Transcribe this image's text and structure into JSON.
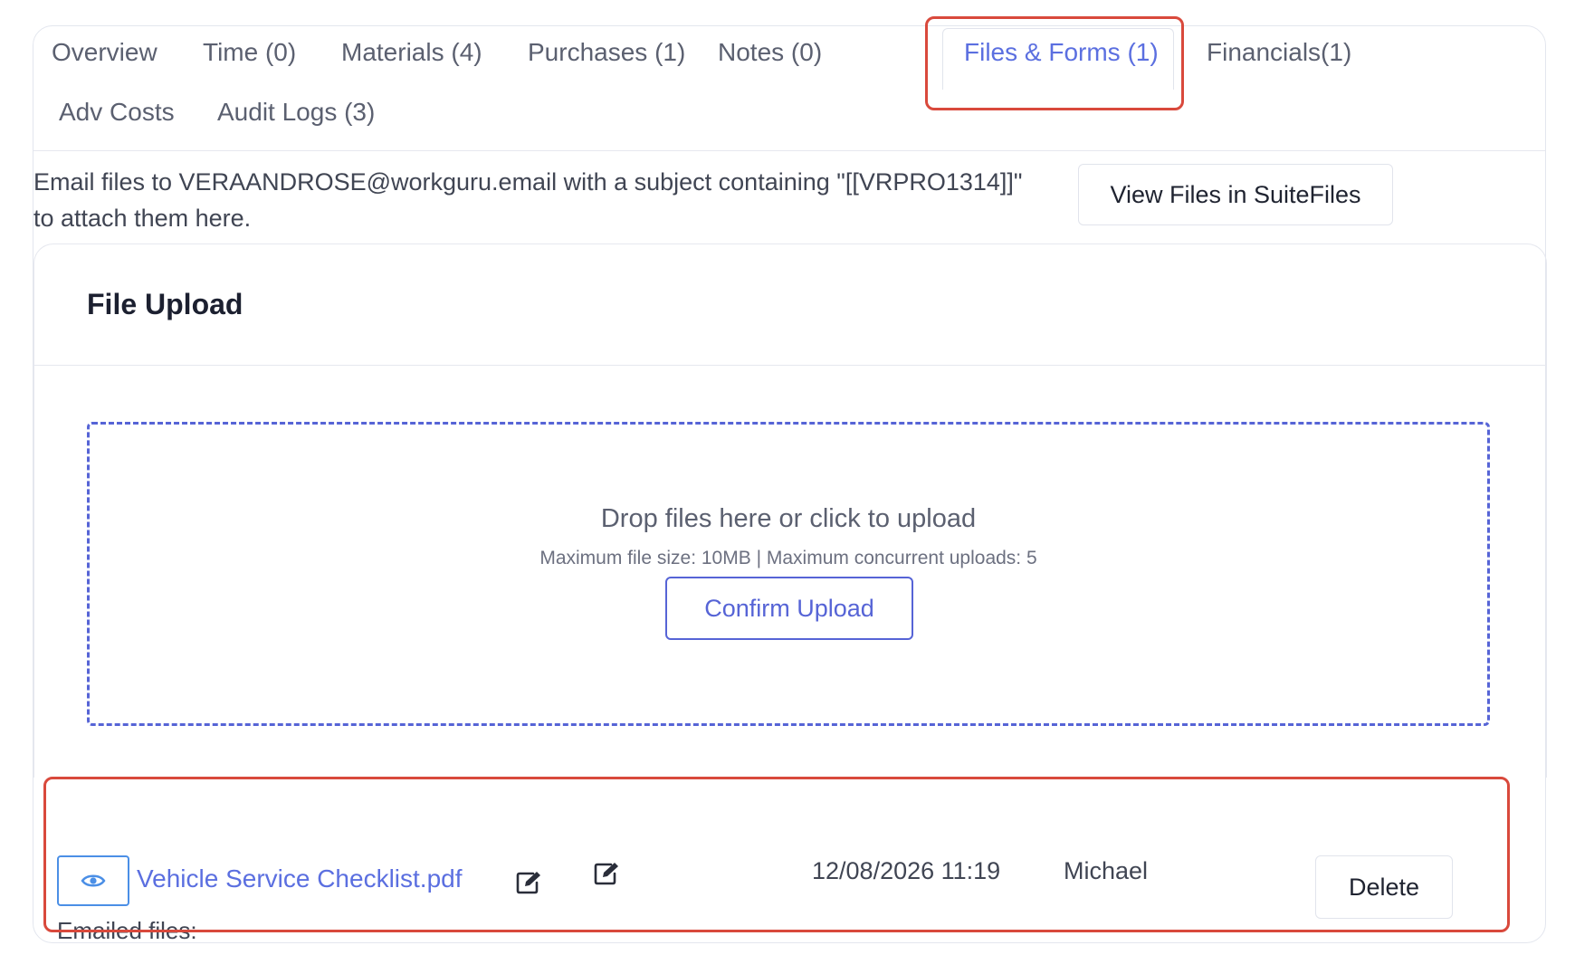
{
  "tabs": [
    {
      "label": "Overview"
    },
    {
      "label": "Time (0)"
    },
    {
      "label": "Materials (4)"
    },
    {
      "label": "Purchases (1)"
    },
    {
      "label": "Notes (0)"
    },
    {
      "label": "Files & Forms (1)",
      "active": true
    },
    {
      "label": "Financials(1)"
    },
    {
      "label": "Adv Costs"
    },
    {
      "label": "Audit Logs (3)"
    }
  ],
  "email_info": {
    "line1": "Email files to VERAANDROSE@workguru.email with a subject containing \"[[VRPRO1314]]\"",
    "line2": "to attach them here."
  },
  "suitefiles_button": "View Files in SuiteFiles",
  "upload": {
    "title": "File Upload",
    "drop_text": "Drop files here or click to upload",
    "limits_text": "Maximum file size: 10MB | Maximum concurrent uploads: 5",
    "confirm_label": "Confirm Upload"
  },
  "files": [
    {
      "name": "Vehicle Service Checklist.pdf",
      "date": "12/08/2026 11:19",
      "user": "Michael",
      "delete_label": "Delete"
    }
  ],
  "emailed_files_label": "Emailed files:",
  "colors": {
    "accent": "#5b6fe0",
    "dropzone_border": "#5664d6",
    "highlight": "#d9493c",
    "view_button_border": "#4b8fe6"
  },
  "icons": {
    "view": "eye-icon",
    "edit": "pencil-square-icon"
  }
}
